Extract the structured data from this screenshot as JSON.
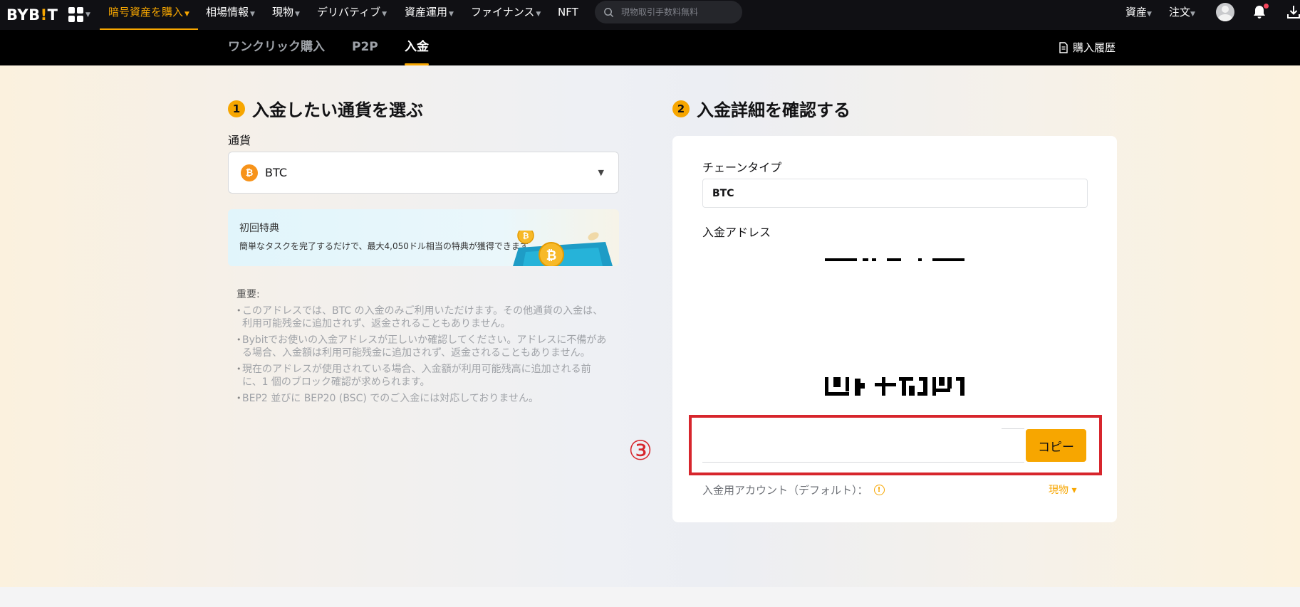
{
  "nav": {
    "logo_pre": "BYB",
    "logo_bang": "!",
    "logo_post": "T",
    "items": [
      {
        "label": "暗号資産を購入"
      },
      {
        "label": "相場情報"
      },
      {
        "label": "現物"
      },
      {
        "label": "デリバティブ"
      },
      {
        "label": "資産運用"
      },
      {
        "label": "ファイナンス"
      },
      {
        "label": "NFT"
      }
    ],
    "search_placeholder": "現物取引手数料無料",
    "assets_label": "資産",
    "orders_label": "注文",
    "accent": "#f7a600"
  },
  "subnav": {
    "tabs": [
      {
        "label": "ワンクリック購入"
      },
      {
        "label": "P2P"
      },
      {
        "label": "入金"
      }
    ],
    "history_label": "購入履歴"
  },
  "left": {
    "step_num": "1",
    "step_title": "入金したい通貨を選ぶ",
    "currency_label": "通貨",
    "currency_value": "BTC",
    "coin_symbol": "₿",
    "promo_title": "初回特典",
    "promo_text": "簡単なタスクを完了するだけで、最大4,050ドル相当の特典が獲得できます。",
    "notes_heading": "重要:",
    "notes": [
      "このアドレスでは、BTC の入金のみご利用いただけます。その他通貨の入金は、利用可能残金に追加されず、返金されることもありません。",
      "Bybitでお使いの入金アドレスが正しいか確認してください。アドレスに不備がある場合、入金額は利用可能残金に追加されず、返金されることもありません。",
      "現在のアドレスが使用されている場合、入金額が利用可能残高に追加される前に、1 個のブロック確認が求められます。",
      "BEP2 並びに BEP20 (BSC) でのご入金には対応しておりません。"
    ]
  },
  "right": {
    "step_num": "2",
    "step_title": "入金詳細を確認する",
    "chain_label": "チェーンタイプ",
    "chain_value": "BTC",
    "address_label": "入金アドレス",
    "address_value": "",
    "copy_label": "コピー",
    "account_label": "入金用アカウント（デフォルト）：",
    "info_glyph": "!",
    "account_value": "現物 ▾"
  },
  "annotation": {
    "marker": "③",
    "color": "#d7252c"
  }
}
